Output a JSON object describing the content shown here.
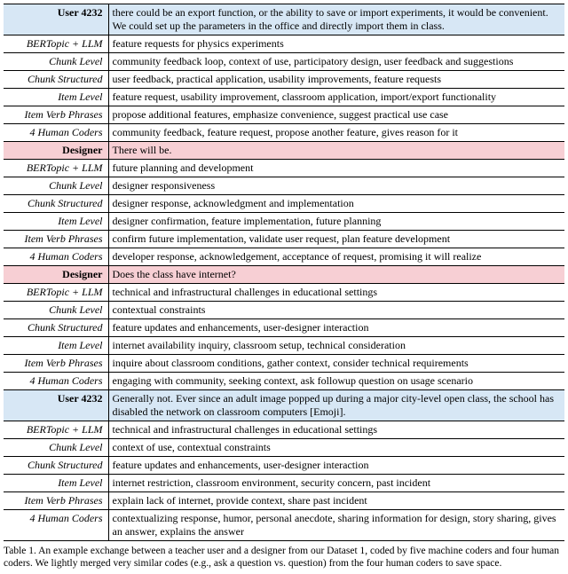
{
  "rows": [
    {
      "kind": "user",
      "label": "User 4232",
      "text": "there could be an export function, or the ability to save or import experiments, it would be convenient. We could set up the parameters in the office and directly import them in class."
    },
    {
      "kind": "coder",
      "label": "BERTopic + LLM",
      "text": "feature requests for physics experiments"
    },
    {
      "kind": "coder",
      "label": "Chunk Level",
      "text": "community feedback loop, context of use, participatory design, user feedback and suggestions"
    },
    {
      "kind": "coder",
      "label": "Chunk Structured",
      "text": "user feedback, practical application, usability improvements, feature requests"
    },
    {
      "kind": "coder",
      "label": "Item Level",
      "text": "feature request, usability improvement, classroom application, import/export functionality"
    },
    {
      "kind": "coder",
      "label": "Item Verb Phrases",
      "text": "propose additional features, emphasize convenience, suggest practical use case"
    },
    {
      "kind": "coder",
      "label": "4 Human Coders",
      "text": "community feedback, feature request, propose another feature, gives reason for it"
    },
    {
      "kind": "designer",
      "label": "Designer",
      "text": "There will be."
    },
    {
      "kind": "coder",
      "label": "BERTopic + LLM",
      "text": "future planning and development"
    },
    {
      "kind": "coder",
      "label": "Chunk Level",
      "text": "designer responsiveness"
    },
    {
      "kind": "coder",
      "label": "Chunk Structured",
      "text": "designer response, acknowledgment and implementation"
    },
    {
      "kind": "coder",
      "label": "Item Level",
      "text": "designer confirmation, feature implementation, future planning"
    },
    {
      "kind": "coder",
      "label": "Item Verb Phrases",
      "text": "confirm future implementation, validate user request, plan feature development"
    },
    {
      "kind": "coder",
      "label": "4 Human Coders",
      "text": "developer response, acknowledgement, acceptance of request, promising it will realize"
    },
    {
      "kind": "designer",
      "label": "Designer",
      "text": "Does the class have internet?"
    },
    {
      "kind": "coder",
      "label": "BERTopic + LLM",
      "text": "technical and infrastructural challenges in educational settings"
    },
    {
      "kind": "coder",
      "label": "Chunk Level",
      "text": "contextual constraints"
    },
    {
      "kind": "coder",
      "label": "Chunk Structured",
      "text": "feature updates and enhancements, user-designer interaction"
    },
    {
      "kind": "coder",
      "label": "Item Level",
      "text": "internet availability inquiry, classroom setup, technical consideration"
    },
    {
      "kind": "coder",
      "label": "Item Verb Phrases",
      "text": "inquire about classroom conditions, gather context, consider technical requirements"
    },
    {
      "kind": "coder",
      "label": "4 Human Coders",
      "text": "engaging with community, seeking context, ask followup question on usage scenario"
    },
    {
      "kind": "user",
      "label": "User 4232",
      "text": "Generally not. Ever since an adult image popped up during a major city-level open class, the school has disabled the network on classroom computers [Emoji]."
    },
    {
      "kind": "coder",
      "label": "BERTopic + LLM",
      "text": "technical and infrastructural challenges in educational settings"
    },
    {
      "kind": "coder",
      "label": "Chunk Level",
      "text": "context of use, contextual constraints"
    },
    {
      "kind": "coder",
      "label": "Chunk Structured",
      "text": "feature updates and enhancements, user-designer interaction"
    },
    {
      "kind": "coder",
      "label": "Item Level",
      "text": "internet restriction, classroom environment, security concern, past incident"
    },
    {
      "kind": "coder",
      "label": "Item Verb Phrases",
      "text": "explain lack of internet, provide context, share past incident"
    },
    {
      "kind": "coder",
      "label": "4 Human Coders",
      "text": "contextualizing response, humor, personal anecdote, sharing information for design, story sharing, gives an answer, explains the answer"
    }
  ],
  "caption": "Table 1.  An example exchange between a teacher user and a designer from our Dataset 1, coded by five machine coders and four human coders. We lightly merged very similar codes (e.g., ask a question vs. question) from the four human coders to save space."
}
